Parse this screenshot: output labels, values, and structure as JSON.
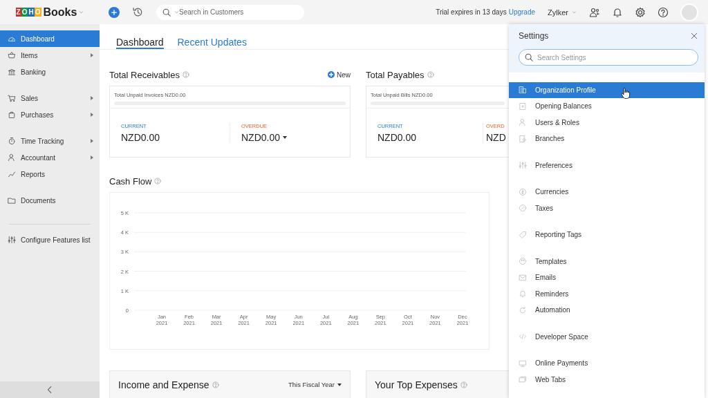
{
  "topbar": {
    "logo_mark": "ZOHO",
    "logo_name": "Books",
    "search": {
      "placeholder": "Search in Customers"
    },
    "trial_text": "Trial expires in 13 days",
    "upgrade_link": "Upgrade",
    "organization": "Zylker"
  },
  "sidebar": {
    "groups": [
      [
        {
          "label": "Dashboard",
          "selected": true,
          "submenu": false
        },
        {
          "label": "Items",
          "selected": false,
          "submenu": true
        },
        {
          "label": "Banking",
          "selected": false,
          "submenu": false
        }
      ],
      [
        {
          "label": "Sales",
          "selected": false,
          "submenu": true
        },
        {
          "label": "Purchases",
          "selected": false,
          "submenu": true
        }
      ],
      [
        {
          "label": "Time Tracking",
          "selected": false,
          "submenu": true
        },
        {
          "label": "Accountant",
          "selected": false,
          "submenu": true
        },
        {
          "label": "Reports",
          "selected": false,
          "submenu": false
        }
      ],
      [
        {
          "label": "Documents",
          "selected": false,
          "submenu": false
        }
      ]
    ],
    "configure": "Configure Features list"
  },
  "tabs": [
    {
      "label": "Dashboard",
      "selected": true
    },
    {
      "label": "Recent Updates",
      "selected": false
    }
  ],
  "receivables": {
    "title": "Total Receivables",
    "new_button": "New",
    "unpaid": "Total Unpaid Invoices NZD0.00",
    "level": 0,
    "current_label": "CURRENT",
    "current_value": "NZD0.00",
    "overdue_label": "OVERDUE",
    "overdue_value": "NZD0.00"
  },
  "payables": {
    "title": "Total Payables",
    "unpaid": "Total Unpaid Bills NZD0.00",
    "level": 0,
    "current_label": "CURRENT",
    "current_value": "NZD0.00",
    "overdue_label": "OVERD",
    "overdue_value": "NZD"
  },
  "cash_flow": {
    "title": "Cash Flow",
    "chart_data": {
      "type": "line",
      "categories": [
        "Jan 2021",
        "Feb 2021",
        "Mar 2021",
        "Apr 2021",
        "May 2021",
        "Jun 2021",
        "Jul 2021",
        "Aug 2021",
        "Sep 2021",
        "Oct 2021",
        "Nov 2021",
        "Dec 2021"
      ],
      "ylim": [
        0,
        5000
      ],
      "grid": true,
      "yticks": [
        {
          "value": 0,
          "label": "0"
        },
        {
          "value": 1000,
          "label": "1 K"
        },
        {
          "value": 2000,
          "label": "2 K"
        },
        {
          "value": 3000,
          "label": "3 K"
        },
        {
          "value": 4000,
          "label": "4 K"
        },
        {
          "value": 5000,
          "label": "5 K"
        }
      ]
    }
  },
  "income_expense": {
    "title": "Income and Expense",
    "period": "This Fiscal Year"
  },
  "top_expenses": {
    "title": "Your Top Expenses"
  },
  "settings_panel": {
    "title": "Settings",
    "search": {
      "placeholder": "Search Settings"
    },
    "groups": [
      [
        {
          "label": "Organization Profile",
          "selected": true
        },
        {
          "label": "Opening Balances",
          "selected": false
        },
        {
          "label": "Users & Roles",
          "selected": false
        },
        {
          "label": "Branches",
          "selected": false
        }
      ],
      [
        {
          "label": "Preferences",
          "selected": false
        }
      ],
      [
        {
          "label": "Currencies",
          "selected": false
        },
        {
          "label": "Taxes",
          "selected": false
        }
      ],
      [
        {
          "label": "Reporting Tags",
          "selected": false
        }
      ],
      [
        {
          "label": "Templates",
          "selected": false
        },
        {
          "label": "Emails",
          "selected": false
        },
        {
          "label": "Reminders",
          "selected": false
        },
        {
          "label": "Automation",
          "selected": false
        }
      ],
      [
        {
          "label": "Developer Space",
          "selected": false
        }
      ],
      [
        {
          "label": "Online Payments",
          "selected": false
        },
        {
          "label": "Web Tabs",
          "selected": false
        }
      ]
    ]
  }
}
